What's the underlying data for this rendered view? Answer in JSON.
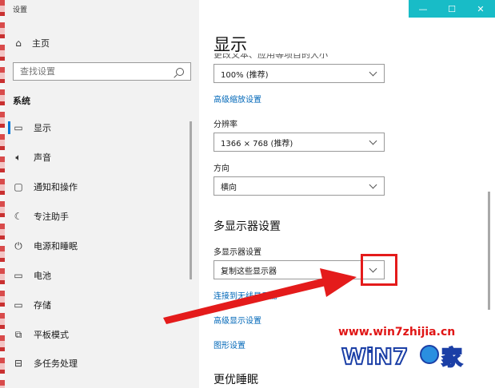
{
  "app_title": "设置",
  "sidebar": {
    "home": {
      "label": "主页",
      "icon": "home-icon"
    },
    "search": {
      "placeholder": "查找设置"
    },
    "section": "系统",
    "items": [
      {
        "label": "显示",
        "icon": "display-icon",
        "selected": true
      },
      {
        "label": "声音",
        "icon": "sound-icon"
      },
      {
        "label": "通知和操作",
        "icon": "notification-icon"
      },
      {
        "label": "专注助手",
        "icon": "moon-icon"
      },
      {
        "label": "电源和睡眠",
        "icon": "power-icon"
      },
      {
        "label": "电池",
        "icon": "battery-icon"
      },
      {
        "label": "存储",
        "icon": "storage-icon"
      },
      {
        "label": "平板模式",
        "icon": "tablet-icon"
      },
      {
        "label": "多任务处理",
        "icon": "multitask-icon"
      }
    ]
  },
  "window_controls": {
    "minimize": "—",
    "maximize": "☐",
    "close": "✕"
  },
  "main": {
    "title": "显示",
    "scale_dropdown": "100% (推荐)",
    "advanced_scaling_link": "高级缩放设置",
    "resolution_label": "分辨率",
    "resolution_dropdown": "1366 × 768 (推荐)",
    "orientation_label": "方向",
    "orientation_dropdown": "横向",
    "multi_display_heading": "多显示器设置",
    "multi_display_label": "多显示器设置",
    "multi_display_dropdown": "复制这些显示器",
    "connect_wireless_link": "连接到无线显示器",
    "advanced_display_link": "高级显示设置",
    "graphics_link": "图形设置",
    "sleep_heading": "更优睡眠"
  },
  "annotation": {
    "color": "#e41b1b"
  },
  "watermark": {
    "url": "www.win7zhijia.cn",
    "logo_text": "WiN7.之家"
  },
  "colors": {
    "accent": "#0078d7",
    "link": "#0067b8",
    "titlebar": "#18bcc7"
  }
}
